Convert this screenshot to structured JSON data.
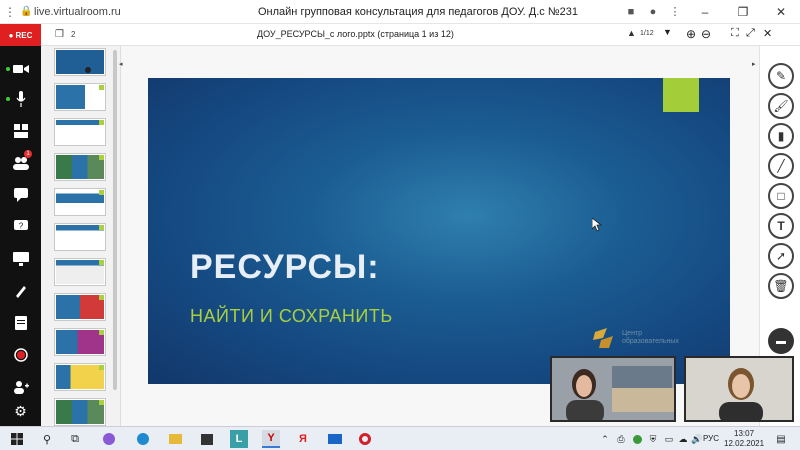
{
  "browser": {
    "url": "live.virtualroom.ru",
    "title": "Онлайн групповая консультация для педагогов ДОУ. Д.с №231"
  },
  "leftbar": {
    "rec_label": "REC",
    "participants_badge": "1"
  },
  "toolbar": {
    "thumb_count": "2",
    "document_title": "ДОУ_РЕСУРСЫ_с лого.pptx (страница 1 из 12)",
    "page_indicator": "1/12"
  },
  "slide": {
    "headline": "РЕСУРСЫ:",
    "subtitle": "НАЙТИ И СОХРАНИТЬ",
    "logo_text_1": "Центр",
    "logo_text_2": "образовательных"
  },
  "taskbar": {
    "language": "РУС",
    "time": "13:07",
    "date": "12.02.2021"
  },
  "colors": {
    "rec": "#e02020",
    "accent_green": "#a3cd39",
    "slide_blue": "#1b5d92"
  }
}
